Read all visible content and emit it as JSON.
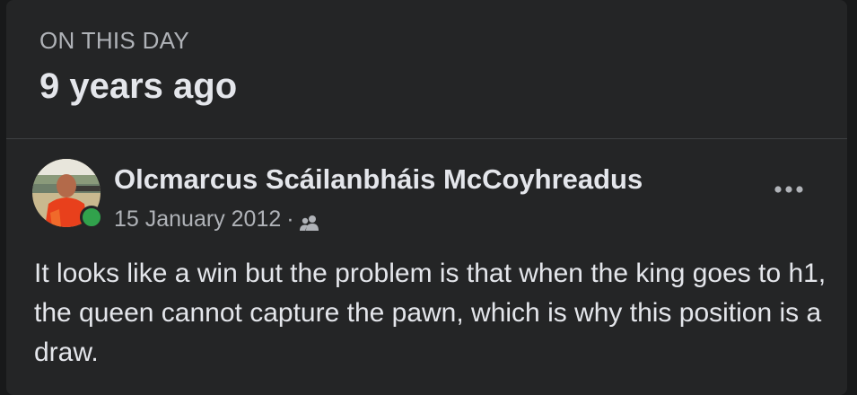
{
  "memory_card": {
    "overline": "ON THIS DAY",
    "title": "9 years ago"
  },
  "post": {
    "author": "Olcmarcus Scáilanbháis McCoyhreadus",
    "date": "15 January 2012",
    "separator": "·",
    "audience_icon": "friends-icon",
    "more_icon": "more-options-icon",
    "online": true,
    "text": "It looks like a win but the problem is that when the king goes to h1, the queen cannot capture the pawn, which is why this position is a draw."
  },
  "colors": {
    "page_background": "#18191a",
    "card_background": "#242526",
    "primary_text": "#e4e6eb",
    "secondary_text": "#b0b3b8",
    "divider": "#3e4042",
    "online_status": "#31a24c"
  }
}
